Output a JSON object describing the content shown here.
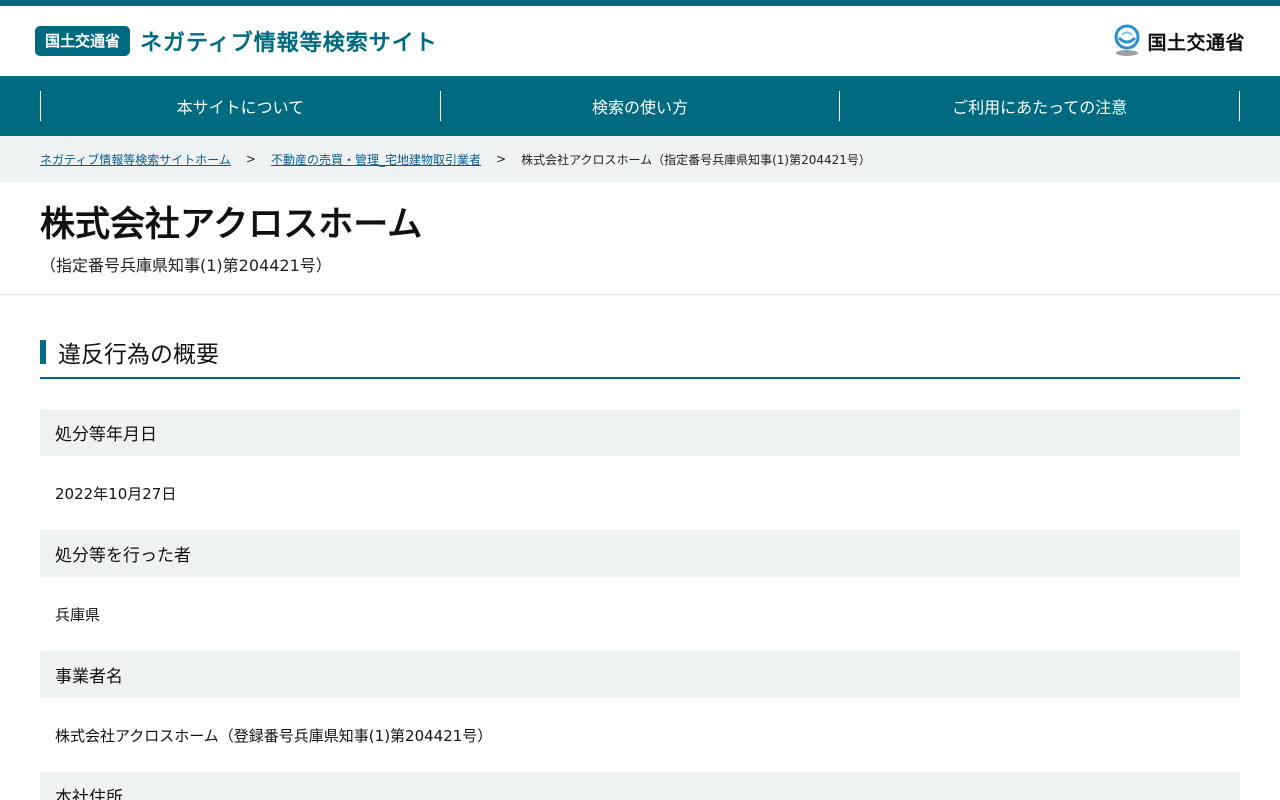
{
  "header": {
    "badge": "国土交通省",
    "site_title": "ネガティブ情報等検索サイト",
    "ministry_name": "国土交通省"
  },
  "nav": {
    "items": [
      {
        "label": "本サイトについて"
      },
      {
        "label": "検索の使い方"
      },
      {
        "label": "ご利用にあたっての注意"
      }
    ]
  },
  "breadcrumb": {
    "home": "ネガティブ情報等検索サイトホーム",
    "category": "不動産の売買・管理_宅地建物取引業者",
    "current": "株式会社アクロスホーム（指定番号兵庫県知事(1)第204421号）",
    "separator": ">"
  },
  "page": {
    "title": "株式会社アクロスホーム",
    "subtitle": "（指定番号兵庫県知事(1)第204421号）"
  },
  "section": {
    "title": "違反行為の概要"
  },
  "details": [
    {
      "label": "処分等年月日",
      "value": "2022年10月27日"
    },
    {
      "label": "処分等を行った者",
      "value": "兵庫県"
    },
    {
      "label": "事業者名",
      "value": "株式会社アクロスホーム（登録番号兵庫県知事(1)第204421号）"
    },
    {
      "label": "本社住所",
      "value": ""
    }
  ],
  "colors": {
    "brand": "#006a80",
    "row_bg": "#eff2f3"
  }
}
